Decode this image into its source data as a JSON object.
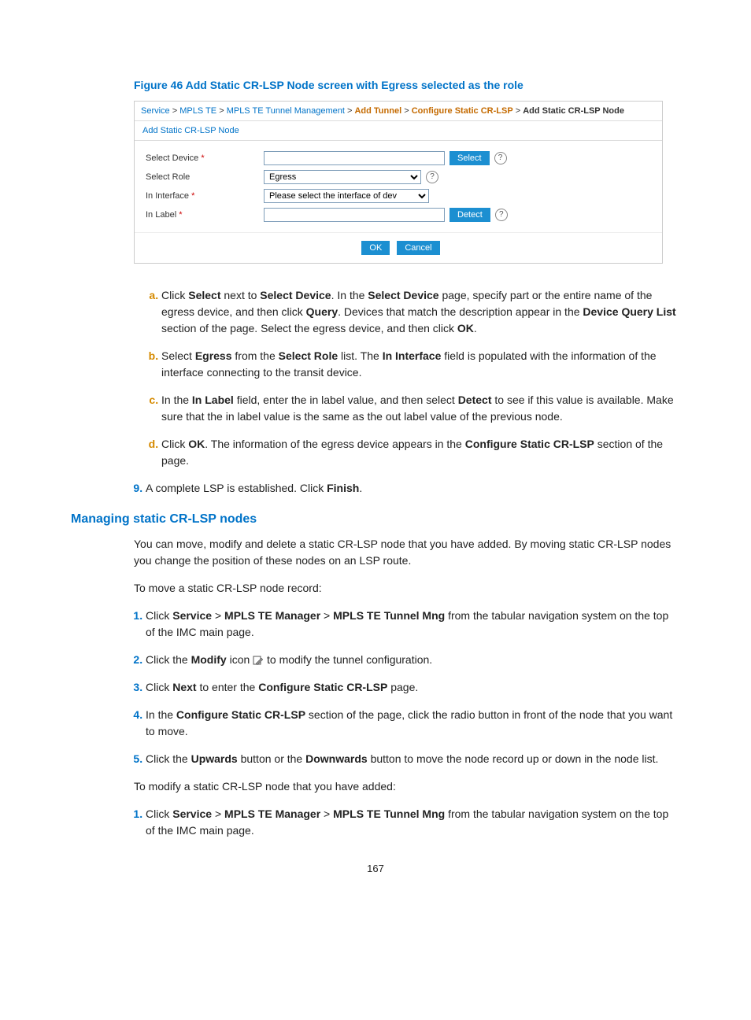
{
  "figure_caption": "Figure 46 Add Static CR-LSP Node screen with Egress selected as the role",
  "breadcrumb": {
    "p1": "Service",
    "p2": "MPLS TE",
    "p3": "MPLS TE Tunnel Management",
    "p4": "Add Tunnel",
    "p5": "Configure Static CR-LSP",
    "p6": "Add Static CR-LSP Node",
    "sep": ">"
  },
  "panel_title": "Add Static CR-LSP Node",
  "form": {
    "select_device_label": "Select Device",
    "select_role_label": "Select Role",
    "role_value": "Egress",
    "in_interface_label": "In Interface",
    "in_interface_placeholder": "Please select the interface of dev",
    "in_label_label": "In Label",
    "select_btn": "Select",
    "detect_btn": "Detect",
    "ok_btn": "OK",
    "cancel_btn": "Cancel",
    "star": "*",
    "help": "?"
  },
  "steps_alpha": {
    "a": {
      "pre": "Click ",
      "b1": "Select",
      "mid1": " next to ",
      "b2": "Select Device",
      "mid2": ". In the ",
      "b3": "Select Device",
      "mid3": " page, specify part or the entire name of the egress device, and then click ",
      "b4": "Query",
      "mid4": ". Devices that match the description appear in the ",
      "b5": "Device Query List",
      "mid5": " section of the page. Select the egress device, and then click ",
      "b6": "OK",
      "post": "."
    },
    "b": {
      "pre": "Select ",
      "b1": "Egress",
      "mid1": " from the ",
      "b2": "Select Role",
      "mid2": " list. The ",
      "b3": "In Interface",
      "post": " field is populated with the information of the interface connecting to the transit device."
    },
    "c": {
      "pre": "In the ",
      "b1": "In Label",
      "mid1": " field, enter the in label value, and then select ",
      "b2": "Detect",
      "post": " to see if this value is available. Make sure that the in label value is the same as the out label value of the previous node."
    },
    "d": {
      "pre": "Click ",
      "b1": "OK",
      "mid1": ". The information of the egress device appears in the ",
      "b2": "Configure Static CR-LSP",
      "post": " section of the page."
    }
  },
  "step9": {
    "pre": "A complete LSP is established. Click ",
    "b1": "Finish",
    "post": "."
  },
  "h2": "Managing static CR-LSP nodes",
  "para1": "You can move, modify and delete a static CR-LSP node that you have added. By moving static CR-LSP nodes you change the position of these nodes on an LSP route.",
  "para2": "To move a static CR-LSP node record:",
  "move_steps": {
    "s1": {
      "pre": "Click ",
      "b1": "Service",
      "sep": " > ",
      "b2": "MPLS TE Manager",
      "b3": "MPLS TE Tunnel Mng",
      "post": " from the tabular navigation system on the top of the IMC main page."
    },
    "s2": {
      "pre": "Click the ",
      "b1": "Modify",
      "mid": " icon ",
      "post": " to modify the tunnel configuration."
    },
    "s3": {
      "pre": "Click ",
      "b1": "Next",
      "mid": " to enter the ",
      "b2": "Configure Static CR-LSP",
      "post": " page."
    },
    "s4": {
      "pre": "In the ",
      "b1": "Configure Static CR-LSP",
      "post": " section of the page, click the radio button in front of the node that you want to move."
    },
    "s5": {
      "pre": "Click the ",
      "b1": "Upwards",
      "mid": " button or the ",
      "b2": "Downwards",
      "post": " button to move the node record up or down in the node list."
    }
  },
  "para3": "To modify a static CR-LSP node that you have added:",
  "mod_steps": {
    "s1": {
      "pre": "Click ",
      "b1": "Service",
      "sep": " > ",
      "b2": "MPLS TE Manager",
      "b3": "MPLS TE Tunnel Mng",
      "post": " from the tabular navigation system on the top of the IMC main page."
    }
  },
  "page_number": "167"
}
